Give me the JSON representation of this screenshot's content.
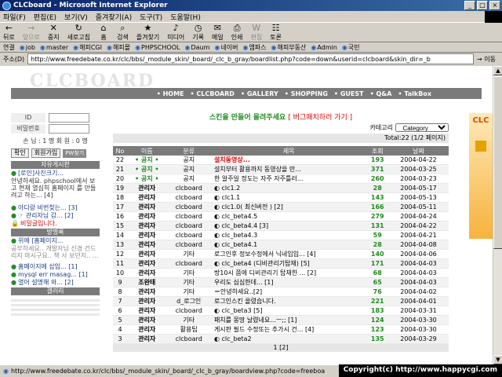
{
  "window": {
    "title": "CLCboard - Microsoft Internet Explorer",
    "min": "_",
    "max": "□",
    "close": "×"
  },
  "menu": [
    "파일(F)",
    "편집(E)",
    "보기(V)",
    "즐겨찾기(A)",
    "도구(T)",
    "도움말(H)"
  ],
  "toolbar": [
    {
      "label": "뒤로",
      "icon": "←",
      "icon_name": "back-arrow-icon",
      "enabled": true
    },
    {
      "label": "앞으로",
      "icon": "→",
      "icon_name": "forward-arrow-icon",
      "enabled": false
    },
    {
      "label": "중지",
      "icon": "✕",
      "icon_name": "stop-icon",
      "enabled": true
    },
    {
      "label": "새로고침",
      "icon": "↻",
      "icon_name": "refresh-icon",
      "enabled": true
    },
    {
      "label": "홈",
      "icon": "⌂",
      "icon_name": "home-icon",
      "enabled": true
    },
    {
      "label": "검색",
      "icon": "⌕",
      "icon_name": "search-icon",
      "enabled": true
    },
    {
      "label": "즐겨찾기",
      "icon": "★",
      "icon_name": "favorites-icon",
      "enabled": true
    },
    {
      "label": "미디어",
      "icon": "♪",
      "icon_name": "media-icon",
      "enabled": true
    },
    {
      "label": "기록",
      "icon": "◷",
      "icon_name": "history-icon",
      "enabled": true
    },
    {
      "label": "메일",
      "icon": "✉",
      "icon_name": "mail-icon",
      "enabled": true
    },
    {
      "label": "인쇄",
      "icon": "⎙",
      "icon_name": "print-icon",
      "enabled": true
    },
    {
      "label": "편집",
      "icon": "W",
      "icon_name": "edit-icon",
      "enabled": false
    },
    {
      "label": "토론",
      "icon": "☷",
      "icon_name": "discuss-icon",
      "enabled": true
    }
  ],
  "links": {
    "label": "연결",
    "items": [
      "job",
      "master",
      "해피CGI",
      "해피몰",
      "PHPSCHOOL",
      "Daum",
      "네이버",
      "엠파스",
      "해피부동산",
      "Admin",
      "국민"
    ]
  },
  "address": {
    "label": "주소(D)",
    "url": "http://www.freedebate.co.kr/clc/bbs/_module_skin/_board/_clc_b_gray/boardlist.php?code=down&userid=clcboard&skin_dir=_b",
    "go": "이동"
  },
  "site": {
    "logo": "CLCBOARD",
    "nav": [
      "• HOME",
      "• CLCBOARD",
      "• GALLERY",
      "• SHOPPING",
      "• GUEST",
      "• Q&A",
      "• TalkBox"
    ]
  },
  "sidebar": {
    "id_label": "ID",
    "pw_label": "비밀번호",
    "members": "손 님 : 1 명   회 원 : 0 명",
    "login_btn": "확인",
    "join_btn": "회원가입",
    "pw_btn": "PW찾기",
    "free_board": "자유게시판",
    "free_items": [
      "[로인]사진크기...",
      "안녕하세요. phpschool에서 보고 현재 열심히 홈페이지 를 만들려고 하는... [4]"
    ],
    "qna_items": [
      "아디랑 비번찾는... [3]",
      "☞ 관리자님 감... [2]",
      "비밀글입니다."
    ],
    "guest_board": "방명록",
    "guest_items": [
      "위에 [홈페이지...",
      "공부하세요.. 개발자님 신경 건드리지 마시구요.. 책 사 보던지.. ..."
    ],
    "misc_items": [
      "홈페이지에 삽입... [1]",
      "mysql err masag... [1]",
      "열어 설명해 와... [2]"
    ],
    "gallery": "갤러리"
  },
  "board": {
    "banner": "스킨을 만들어 올려주세요",
    "banner_link": "[ 버그패치하러 가기 ]",
    "category_label": "카테고리",
    "category_value": "_Category_",
    "total": "Total:22    (1/2 페이지)",
    "columns": [
      "No",
      "이름",
      "분류",
      "제목",
      "조회",
      "날짜"
    ],
    "rows": [
      {
        "no": "22",
        "name": "• 공지 •",
        "cat": "공지",
        "title": "설치동영상...",
        "hits": "193",
        "date": "2004-04-22",
        "notice": true,
        "hot": true
      },
      {
        "no": "21",
        "name": "• 공지 •",
        "cat": "공지",
        "title": "설치부터 활용까지 동영상을 만...",
        "hits": "371",
        "date": "2004-03-25",
        "notice": true
      },
      {
        "no": "20",
        "name": "• 공지 •",
        "cat": "공지",
        "title": "한 알주일 정도는 자주 자주틀러...",
        "hits": "260",
        "date": "2004-03-23",
        "notice": true
      },
      {
        "no": "19",
        "name": "관리자",
        "cat": "clcboard",
        "title": "◐ clc1.2",
        "hits": "28",
        "date": "2004-05-17"
      },
      {
        "no": "18",
        "name": "관리자",
        "cat": "clcboard",
        "title": "◐ clc1.1",
        "hits": "143",
        "date": "2004-05-13"
      },
      {
        "no": "17",
        "name": "관리자",
        "cat": "clcboard",
        "title": "◐ clc1.0( 최신버전 ) [2]",
        "hits": "166",
        "date": "2004-05-11"
      },
      {
        "no": "16",
        "name": "관리자",
        "cat": "clcboard",
        "title": "◐ clc_beta4.5",
        "hits": "279",
        "date": "2004-04-24"
      },
      {
        "no": "15",
        "name": "관리자",
        "cat": "clcboard",
        "title": "◐ clc_beta4.4 [3]",
        "hits": "131",
        "date": "2004-04-22"
      },
      {
        "no": "14",
        "name": "관리자",
        "cat": "clcboard",
        "title": "◐ clc_beta4.3",
        "hits": "59",
        "date": "2004-04-21"
      },
      {
        "no": "13",
        "name": "관리자",
        "cat": "clcboard",
        "title": "◐ clc_beta4.1",
        "hits": "28",
        "date": "2004-04-08"
      },
      {
        "no": "12",
        "name": "관리자",
        "cat": "기타",
        "title": "로그인후 정보수정에서 닉네임입... [4]",
        "hits": "140",
        "date": "2004-04-06"
      },
      {
        "no": "11",
        "name": "관리자",
        "cat": "clcboard",
        "title": "◐ clc_beta4 (디비관리기탑재) [5]",
        "hits": "171",
        "date": "2004-04-03"
      },
      {
        "no": "10",
        "name": "관리자",
        "cat": "기타",
        "title": "방10시 쯤에 디비관리기 탑재한 ... [2]",
        "hits": "68",
        "date": "2004-04-03"
      },
      {
        "no": "9",
        "name": "조완태",
        "cat": "기타",
        "title": "우리도 심심한데... [1]",
        "hits": "65",
        "date": "2004-04-03"
      },
      {
        "no": "8",
        "name": "관리자",
        "cat": "기타",
        "title": "＝안녕하세요..[2]",
        "hits": "76",
        "date": "2004-04-02"
      },
      {
        "no": "7",
        "name": "관리자",
        "cat": "d_로그인",
        "title": "로그인스킨 올렸습니다.",
        "hits": "221",
        "date": "2004-04-01"
      },
      {
        "no": "6",
        "name": "관리자",
        "cat": "clcboard",
        "title": "◐ clc_beta3 [5]",
        "hits": "183",
        "date": "2004-03-31"
      },
      {
        "no": "5",
        "name": "관리자",
        "cat": "기타",
        "title": "패치를 몽땅 날렸네요...ㅡ;; [1]",
        "hits": "124",
        "date": "2004-03-30"
      },
      {
        "no": "4",
        "name": "관리자",
        "cat": "활용팁",
        "title": "게시판 필드 수정또는 추가시 건... [4]",
        "hits": "123",
        "date": "2004-03-30"
      },
      {
        "no": "3",
        "name": "관리자",
        "cat": "clcboard",
        "title": "◐ clc_beta2",
        "hits": "135",
        "date": "2004-03-29"
      }
    ],
    "pager": "1 [2]"
  },
  "status": {
    "url": "http://www.freedebate.co.kr/clc/bbs/_module_skin/_board/_clc_b_gray/boardview.php?code=freeboa",
    "copyright": "Copyright(c) http://www.happycgi.com"
  },
  "deco_text": "CLC"
}
